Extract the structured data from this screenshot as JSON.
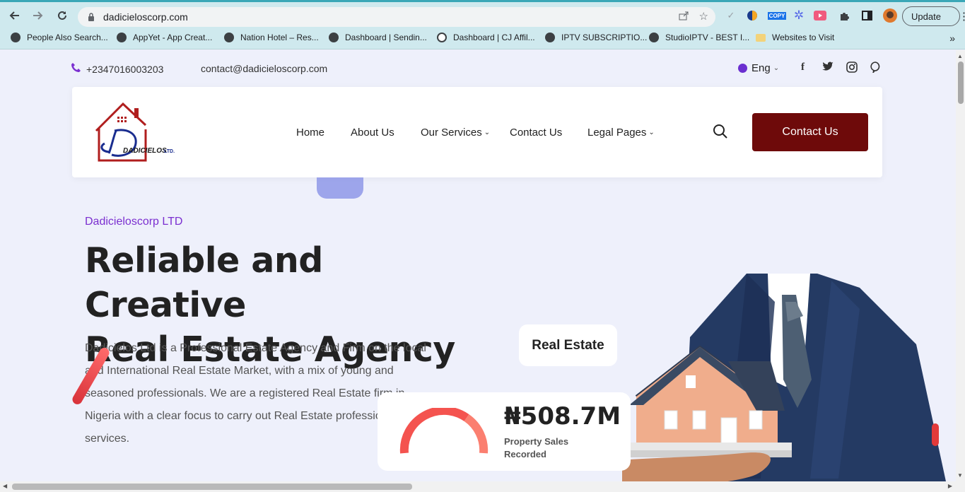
{
  "browser": {
    "url": "dadicieloscorp.com",
    "update_label": "Update",
    "ext_copy_label": "COPY",
    "bookmarks": [
      {
        "label": "People Also Search..."
      },
      {
        "label": "AppYet - App Creat..."
      },
      {
        "label": "Nation Hotel – Res..."
      },
      {
        "label": "Dashboard | Sendin..."
      },
      {
        "label": "Dashboard | CJ Affil..."
      },
      {
        "label": "IPTV SUBSCRIPTIO..."
      },
      {
        "label": "StudioIPTV - BEST I..."
      },
      {
        "label": "Websites to Visit"
      }
    ]
  },
  "topbar": {
    "phone": "+2347016003203",
    "email": "contact@dadicieloscorp.com",
    "language": "Eng"
  },
  "header": {
    "logo_text": "DADICIELOS",
    "logo_suffix": "LTD.",
    "menu": [
      "Home",
      "About Us",
      "Our Services",
      "Contact Us",
      "Legal Pages"
    ],
    "cta_label": "Contact Us"
  },
  "hero": {
    "eyebrow": "Dadicieloscorp LTD",
    "title_line1": "Reliable and Creative",
    "title_line2": "Real Estate Agency",
    "description": "Dadicielos Ltd is a Professional Estate Agency and Firm on the local and International Real Estate Market, with a mix of young and seasoned professionals. We are a registered Real Estate firm in Nigeria with a clear focus to carry out Real Estate professional services.",
    "badge_label": "Real Estate",
    "stat_value": "₦508.7M",
    "stat_label": "Property Sales Recorded"
  },
  "colors": {
    "brand_dark_red": "#6e0a0a",
    "accent_purple": "#7b2fd0",
    "page_bg": "#eef0fb",
    "browser_chrome": "#cfe9ee"
  }
}
